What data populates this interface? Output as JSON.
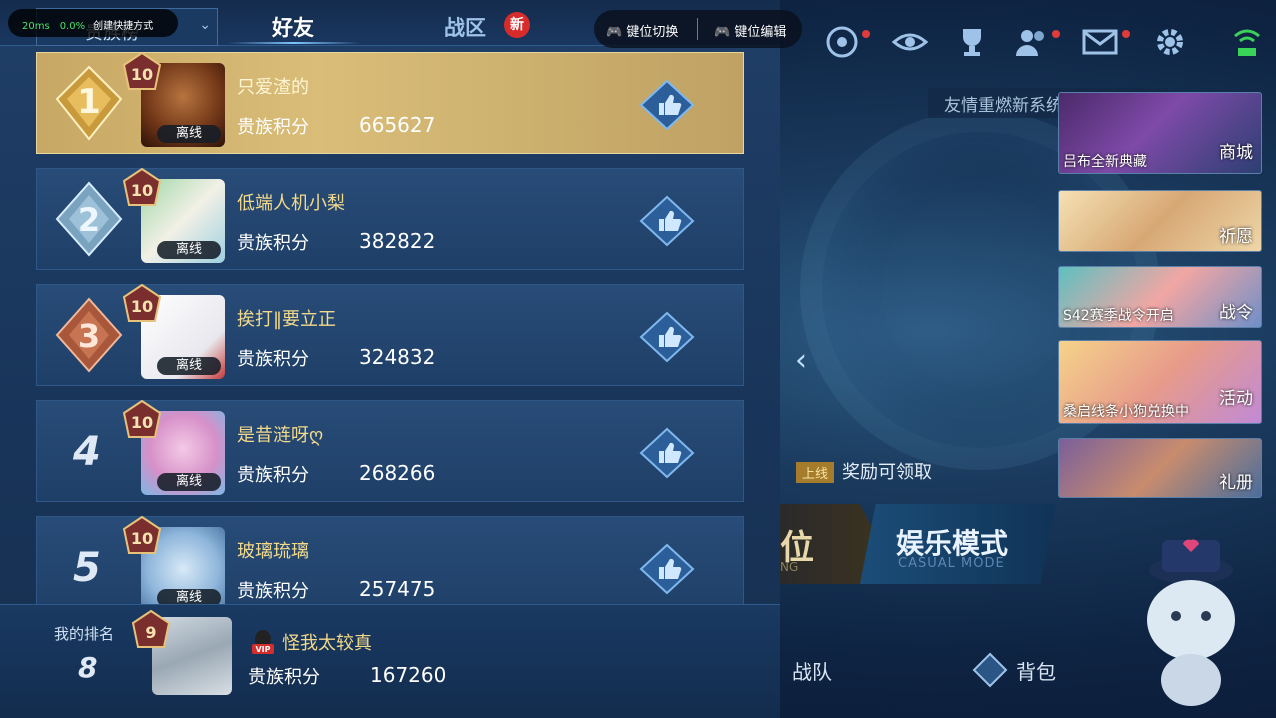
{
  "overlay": {
    "fps": "20ms",
    "pct": "0.0%",
    "shortcut": "创建快捷方式",
    "key_switch": "键位切换",
    "key_edit": "键位编辑"
  },
  "tabs": {
    "dropdown": "贵族榜",
    "friends": "好友",
    "zone": "战区",
    "new_badge": "新"
  },
  "rows": [
    {
      "rank": "1",
      "level": "10",
      "name": "只爱渣的",
      "status": "离线",
      "score_label": "贵族积分",
      "score": "665627"
    },
    {
      "rank": "2",
      "level": "10",
      "name": "低端人机小梨",
      "status": "离线",
      "score_label": "贵族积分",
      "score": "382822"
    },
    {
      "rank": "3",
      "level": "10",
      "name": "挨打‖要立正",
      "status": "离线",
      "score_label": "贵族积分",
      "score": "324832"
    },
    {
      "rank": "4",
      "level": "10",
      "name": "是昔涟呀ღ",
      "status": "离线",
      "score_label": "贵族积分",
      "score": "268266"
    },
    {
      "rank": "5",
      "level": "10",
      "name": "玻璃琉璃",
      "status": "离线",
      "score_label": "贵族积分",
      "score": "257475"
    }
  ],
  "mine": {
    "label": "我的排名",
    "rank": "8",
    "level": "9",
    "name": "怪我太较真",
    "score_label": "贵族积分",
    "score": "167260",
    "vip": "VIP"
  },
  "right": {
    "notice": "友情重燃新系统上线",
    "cards": [
      {
        "caption": "吕布全新典藏",
        "tag": "商城"
      },
      {
        "caption": "",
        "tag": "祈愿"
      },
      {
        "caption": "S42赛季战令开启",
        "tag": "战令"
      },
      {
        "caption": "桑启线条小狗兑换中",
        "tag": "活动"
      },
      {
        "caption": "",
        "tag": "礼册"
      }
    ],
    "reward_up": "上线",
    "reward": "奖励可领取",
    "mode_rank": "位",
    "mode_rank_sub": "NG",
    "mode_casual": "娱乐模式",
    "mode_casual_sub": "CASUAL MODE",
    "nav_team": "战队",
    "nav_bag": "背包"
  },
  "icons": [
    "radar-icon",
    "eye-icon",
    "trophy-icon",
    "friends-icon",
    "mail-icon",
    "gear-icon",
    "wifi-battery-icon"
  ]
}
